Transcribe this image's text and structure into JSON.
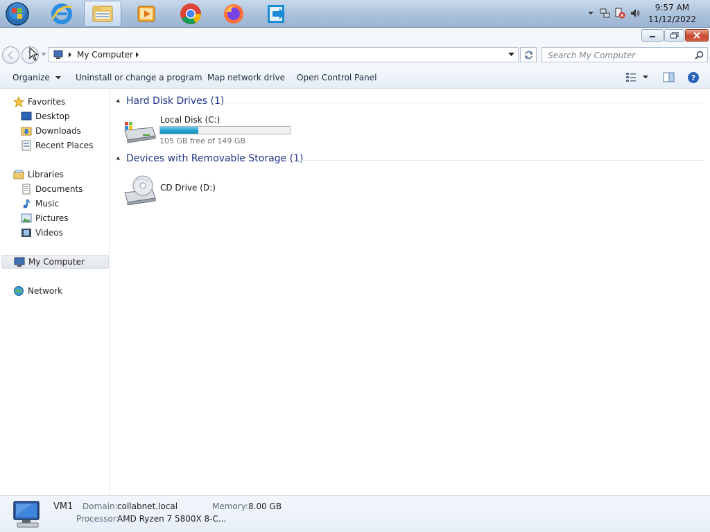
{
  "taskbar": {
    "apps": [
      "windows-explorer",
      "internet-explorer",
      "media-player",
      "chrome",
      "firefox",
      "remote-app"
    ],
    "clock_time": "9:57 AM",
    "clock_date": "11/12/2022"
  },
  "address": {
    "path": "My Computer",
    "search_placeholder": "Search My Computer"
  },
  "commands": {
    "organize": "Organize",
    "uninstall": "Uninstall or change a program",
    "map_drive": "Map network drive",
    "control_panel": "Open Control Panel"
  },
  "nav": {
    "favorites": "Favorites",
    "desktop": "Desktop",
    "downloads": "Downloads",
    "recent": "Recent Places",
    "libraries": "Libraries",
    "documents": "Documents",
    "music": "Music",
    "pictures": "Pictures",
    "videos": "Videos",
    "computer": "My Computer",
    "network": "Network"
  },
  "groups": {
    "hdd_header": "Hard Disk Drives (1)",
    "removable_header": "Devices with Removable Storage (1)"
  },
  "drives": {
    "c_name": "Local Disk (C:)",
    "c_free": "105 GB free of 149 GB",
    "c_used_fraction": 0.295,
    "d_name": "CD Drive (D:)"
  },
  "details": {
    "computer_name": "VM1",
    "domain_label": "Domain:",
    "domain_value": "collabnet.local",
    "memory_label": "Memory:",
    "memory_value": "8.00 GB",
    "processor_label": "Processor:",
    "processor_value": "AMD Ryzen 7 5800X 8-C..."
  },
  "colors": {
    "accent": "#1e3287",
    "bar_fill": "#1f9dc8"
  }
}
